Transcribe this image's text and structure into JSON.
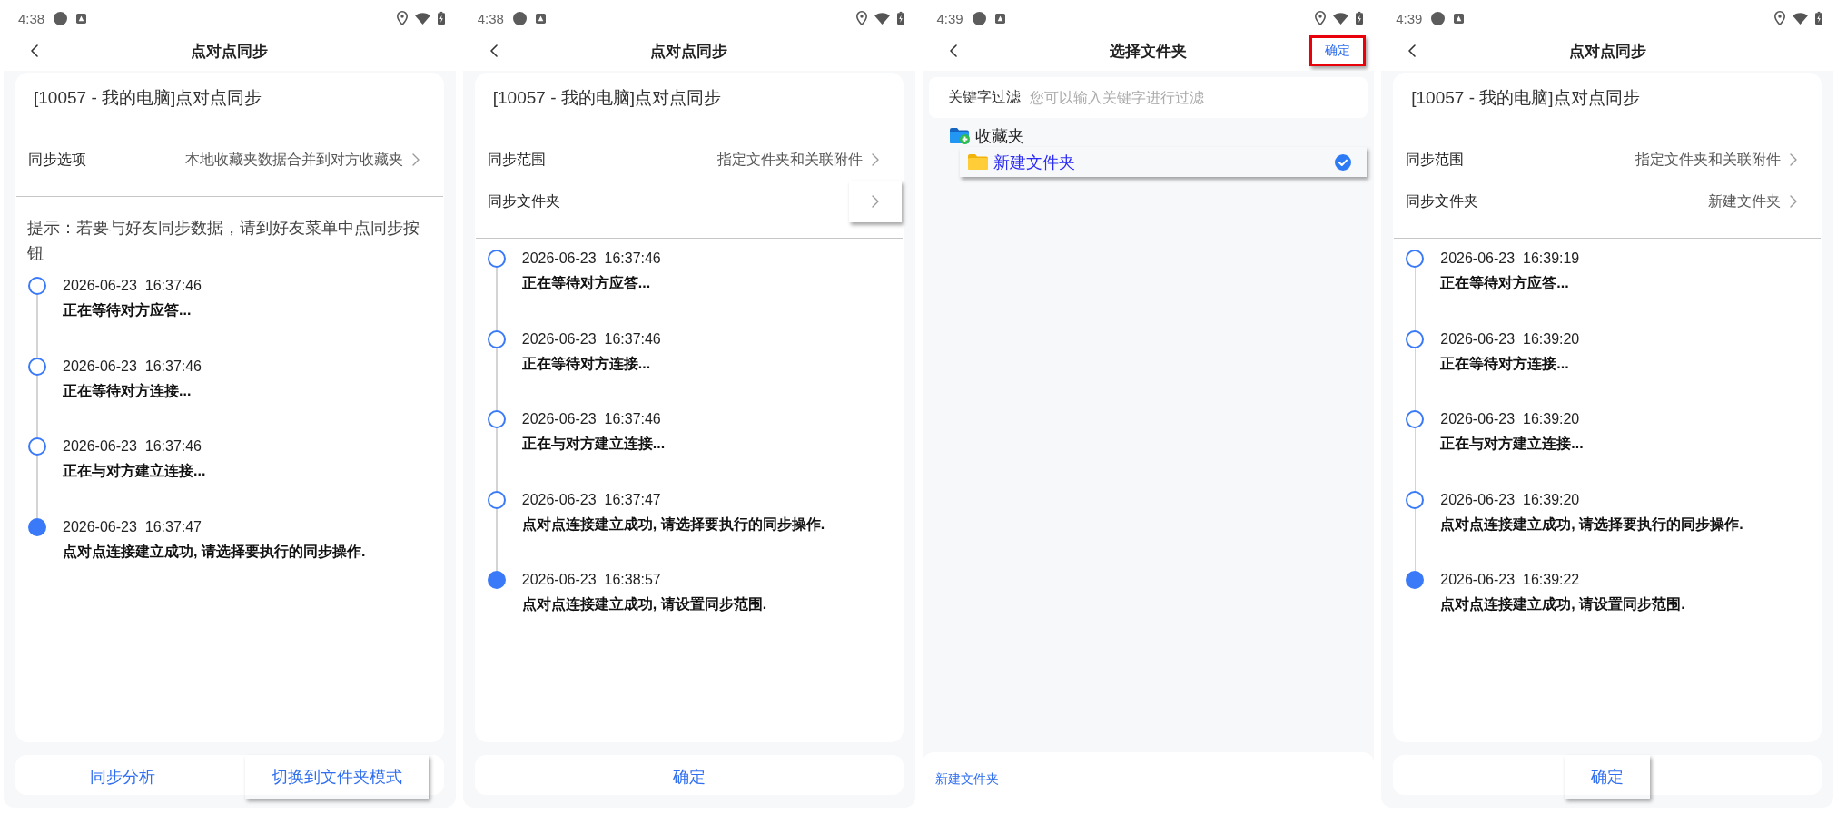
{
  "screens": [
    {
      "kind": "sync",
      "status_bar": {
        "time": "4:38"
      },
      "title": "点对点同步",
      "header": "[10057 - 我的电脑]点对点同步",
      "options": [
        {
          "label": "同步选项",
          "value": "本地收藏夹数据合并到对方收藏夹",
          "highlighted": false
        }
      ],
      "hint": "提示：若要与好友同步数据，请到好友菜单中点同步按钮",
      "timeline": [
        {
          "time": "2026-06-23  16:37:46",
          "message": "正在等待对方应答...",
          "active": false
        },
        {
          "time": "2026-06-23  16:37:46",
          "message": "正在等待对方连接...",
          "active": false
        },
        {
          "time": "2026-06-23  16:37:46",
          "message": "正在与对方建立连接...",
          "active": false
        },
        {
          "time": "2026-06-23  16:37:47",
          "message": "点对点连接建立成功, 请选择要执行的同步操作.",
          "active": true
        }
      ],
      "bottom_buttons": [
        {
          "label": "同步分析",
          "highlighted": false
        },
        {
          "label": "切换到文件夹模式",
          "highlighted": true
        }
      ]
    },
    {
      "kind": "sync",
      "status_bar": {
        "time": "4:38"
      },
      "title": "点对点同步",
      "header": "[10057 - 我的电脑]点对点同步",
      "options": [
        {
          "label": "同步范围",
          "value": "指定文件夹和关联附件",
          "highlighted": false
        },
        {
          "label": "同步文件夹",
          "highlighted": true
        }
      ],
      "timeline": [
        {
          "time": "2026-06-23  16:37:46",
          "message": "正在等待对方应答...",
          "active": false
        },
        {
          "time": "2026-06-23  16:37:46",
          "message": "正在等待对方连接...",
          "active": false
        },
        {
          "time": "2026-06-23  16:37:46",
          "message": "正在与对方建立连接...",
          "active": false
        },
        {
          "time": "2026-06-23  16:37:47",
          "message": "点对点连接建立成功, 请选择要执行的同步操作.",
          "active": false
        },
        {
          "time": "2026-06-23  16:38:57",
          "message": "点对点连接建立成功, 请设置同步范围.",
          "active": true
        }
      ],
      "bottom_buttons": [
        {
          "label": "确定",
          "highlighted": false
        }
      ]
    },
    {
      "kind": "folder_picker",
      "status_bar": {
        "time": "4:39"
      },
      "title": "选择文件夹",
      "action": {
        "label": "确定",
        "highlighted": true
      },
      "filter": {
        "label": "关键字过滤",
        "placeholder": "您可以输入关键字进行过滤"
      },
      "tree": [
        {
          "label": "收藏夹",
          "selected": false,
          "highlighted": false,
          "children": [
            {
              "label": "新建文件夹",
              "selected": true,
              "highlighted": true
            }
          ]
        }
      ],
      "bottom_link": {
        "label": "新建文件夹"
      }
    },
    {
      "kind": "sync",
      "status_bar": {
        "time": "4:39"
      },
      "title": "点对点同步",
      "header": "[10057 - 我的电脑]点对点同步",
      "options": [
        {
          "label": "同步范围",
          "value": "指定文件夹和关联附件",
          "highlighted": false
        },
        {
          "label": "同步文件夹",
          "value": "新建文件夹",
          "highlighted": false
        }
      ],
      "timeline": [
        {
          "time": "2026-06-23  16:39:19",
          "message": "正在等待对方应答...",
          "active": false
        },
        {
          "time": "2026-06-23  16:39:20",
          "message": "正在等待对方连接...",
          "active": false
        },
        {
          "time": "2026-06-23  16:39:20",
          "message": "正在与对方建立连接...",
          "active": false
        },
        {
          "time": "2026-06-23  16:39:20",
          "message": "点对点连接建立成功, 请选择要执行的同步操作.",
          "active": false
        },
        {
          "time": "2026-06-23  16:39:22",
          "message": "点对点连接建立成功, 请设置同步范围.",
          "active": true
        }
      ],
      "bottom_buttons": [
        {
          "label": "确定",
          "highlighted": true
        }
      ]
    }
  ]
}
